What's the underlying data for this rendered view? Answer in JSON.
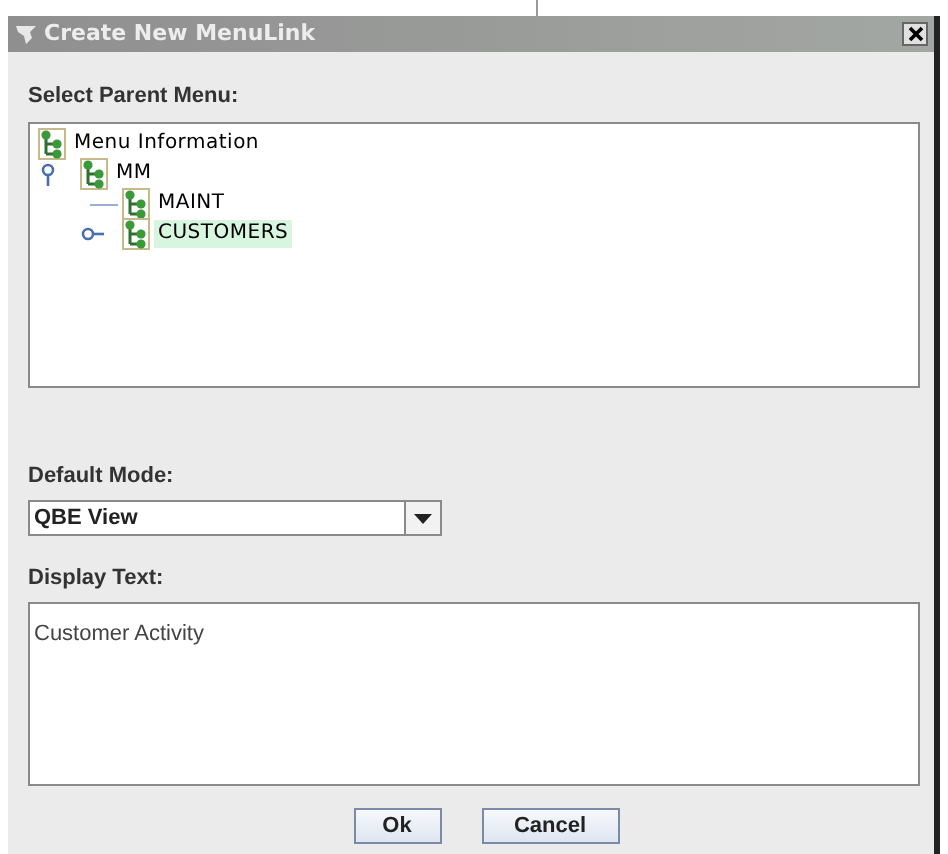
{
  "window": {
    "title": "Create New MenuLink"
  },
  "parent_menu": {
    "label": "Select Parent Menu:",
    "tree": [
      {
        "label": "Menu Information",
        "selected": false,
        "expanded": true,
        "children": [
          {
            "label": "MM",
            "selected": false,
            "expanded": true,
            "children": [
              {
                "label": "MAINT",
                "selected": false
              },
              {
                "label": "CUSTOMERS",
                "selected": true,
                "expanded": false
              }
            ]
          }
        ]
      }
    ]
  },
  "default_mode": {
    "label": "Default Mode:",
    "value": "QBE View"
  },
  "display_text": {
    "label": "Display Text:",
    "value": "Customer Activity"
  },
  "buttons": [
    "Ok",
    "Cancel"
  ]
}
